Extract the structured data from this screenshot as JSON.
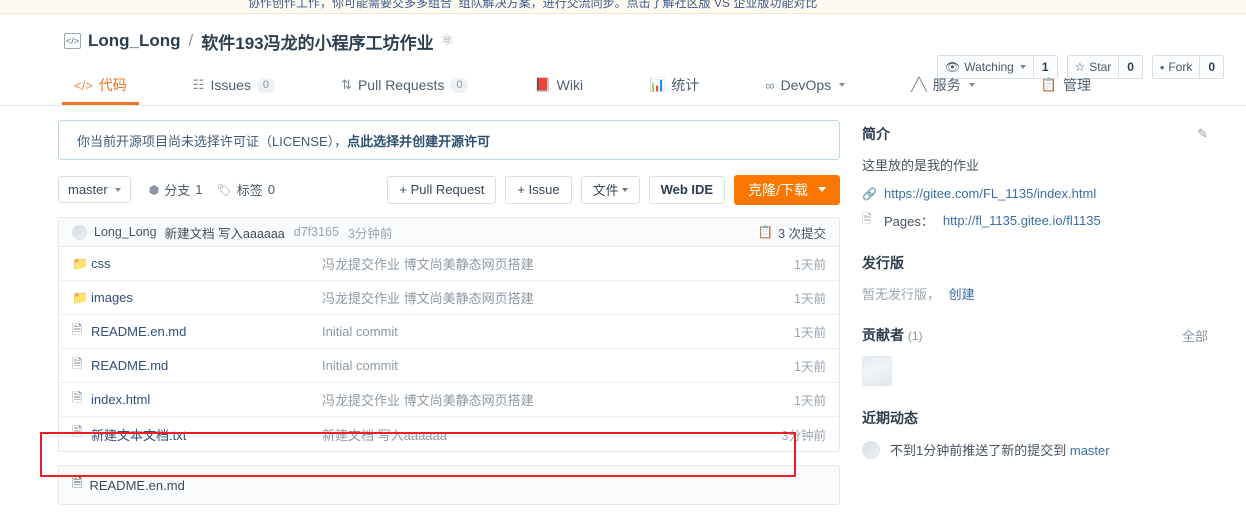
{
  "top_notice": "协作创作工作，你可能需要交多多组合  组队解决方案，进行交流同步。点击了解社区版 VS 企业版功能对比",
  "repo": {
    "owner": "Long_Long",
    "separator": "/",
    "name": "软件193冯龙的小程序工坊作业",
    "code_icon": "code-icon",
    "badge_icon": "award-badge-icon"
  },
  "head_actions": {
    "watch": {
      "icon": "eye-icon",
      "label": "Watching",
      "count": "1"
    },
    "star": {
      "icon": "star-icon",
      "label": "Star",
      "count": "0"
    },
    "fork": {
      "icon": "fork-icon",
      "label": "Fork",
      "count": "0"
    }
  },
  "nav": [
    {
      "icon": "code-brackets-icon",
      "label": "代码",
      "count": null,
      "active": true,
      "caret": false
    },
    {
      "icon": "issue-list-icon",
      "label": "Issues",
      "count": "0",
      "active": false,
      "caret": false
    },
    {
      "icon": "pull-request-icon",
      "label": "Pull Requests",
      "count": "0",
      "active": false,
      "caret": false
    },
    {
      "icon": "book-icon",
      "label": "Wiki",
      "count": null,
      "active": false,
      "caret": false
    },
    {
      "icon": "chart-icon",
      "label": "统计",
      "count": null,
      "active": false,
      "caret": false
    },
    {
      "icon": "infinity-icon",
      "label": "DevOps",
      "count": null,
      "active": false,
      "caret": true
    },
    {
      "icon": "pulse-icon",
      "label": "服务",
      "count": null,
      "active": false,
      "caret": true
    },
    {
      "icon": "settings-doc-icon",
      "label": "管理",
      "count": null,
      "active": false,
      "caret": false
    }
  ],
  "license_banner": {
    "text": "你当前开源项目尚未选择许可证（LICENSE），",
    "link": "点此选择并创建开源许可"
  },
  "toolbar": {
    "branch": "master",
    "branches": {
      "icon": "branch-icon",
      "label": "分支",
      "count": "1"
    },
    "tags": {
      "icon": "tag-icon",
      "label": "标签",
      "count": "0"
    },
    "pull_request": "+ Pull Request",
    "issue": "+ Issue",
    "files": "文件",
    "web_ide": "Web IDE",
    "clone": "克隆/下载"
  },
  "commit_bar": {
    "avatar": "user-avatar",
    "author": "Long_Long",
    "message": "新建文档 写入aaaaaa",
    "sha": "d7f3165",
    "time": "3分钟前",
    "commits_icon": "commit-history-icon",
    "commits_label": "3 次提交"
  },
  "files": [
    {
      "icon": "folder-icon",
      "name": "css",
      "message": "冯龙提交作业 博文尚美静态网页搭建",
      "age": "1天前",
      "highlighted": false
    },
    {
      "icon": "folder-icon",
      "name": "images",
      "message": "冯龙提交作业 博文尚美静态网页搭建",
      "age": "1天前",
      "highlighted": false
    },
    {
      "icon": "file-icon",
      "name": "README.en.md",
      "message": "Initial commit",
      "age": "1天前",
      "highlighted": false
    },
    {
      "icon": "file-icon",
      "name": "README.md",
      "message": "Initial commit",
      "age": "1天前",
      "highlighted": false
    },
    {
      "icon": "file-icon",
      "name": "index.html",
      "message": "冯龙提交作业 博文尚美静态网页搭建",
      "age": "1天前",
      "highlighted": false
    },
    {
      "icon": "file-icon",
      "name": "新建文本文档.txt",
      "message": "新建文档 写入aaaaaa",
      "age": "3分钟前",
      "highlighted": true
    }
  ],
  "readme_stub": {
    "icon": "file-icon",
    "name": "README.en.md"
  },
  "highlight_color": "#ee1c25",
  "accent_color": "#f07122",
  "clone_button_color": "#f97600",
  "sidebar": {
    "intro": {
      "title": "简介",
      "edit_icon": "edit-pencil-icon",
      "description": "这里放的是我的作业",
      "homepage": {
        "icon": "link-chain-icon",
        "url": "https://gitee.com/FL_1135/index.html"
      },
      "pages": {
        "icon": "page-icon",
        "label": "Pages：",
        "url": "http://fl_1135.gitee.io/fl1135"
      }
    },
    "releases": {
      "title": "发行版",
      "empty_text": "暂无发行版，",
      "action": "创建"
    },
    "contributors": {
      "title": "贡献者",
      "count": "(1)",
      "all": "全部",
      "avatar": "contributor-avatar"
    },
    "activity": {
      "title": "近期动态",
      "avatar": "user-avatar",
      "text": "不到1分钟前推送了新的提交到",
      "ref": "master"
    }
  }
}
